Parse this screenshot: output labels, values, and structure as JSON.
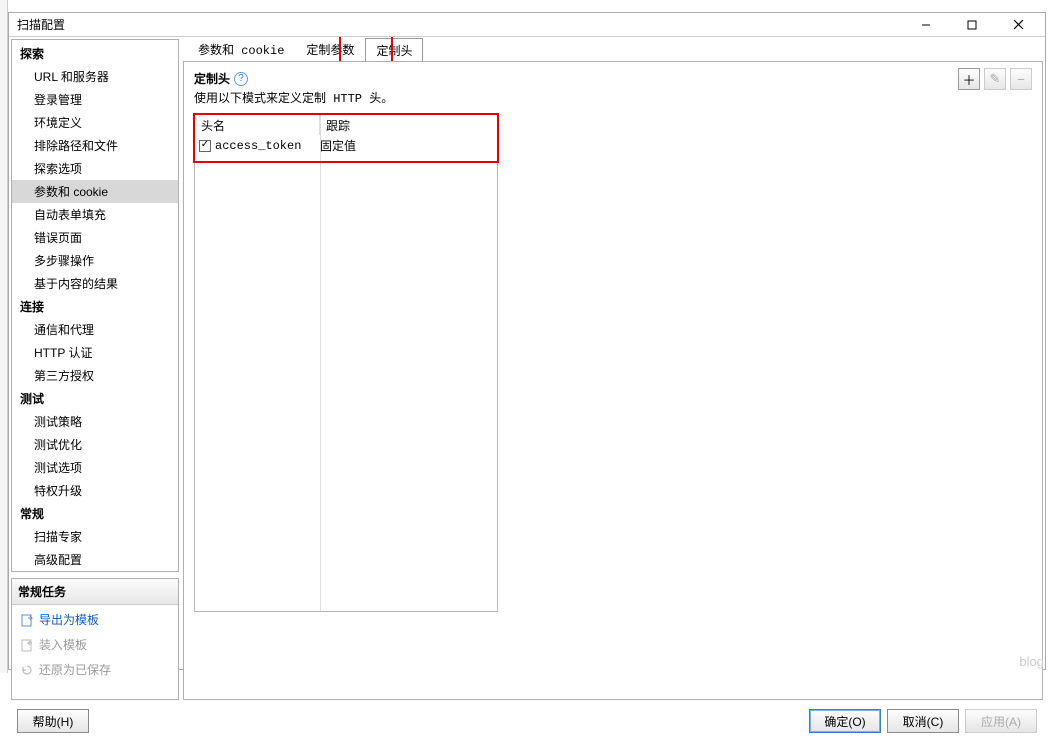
{
  "window": {
    "title": "扫描配置"
  },
  "sidebar": {
    "groups": [
      {
        "label": "探索",
        "items": [
          "URL 和服务器",
          "登录管理",
          "环境定义",
          "排除路径和文件",
          "探索选项",
          "参数和 cookie",
          "自动表单填充",
          "错误页面",
          "多步骤操作",
          "基于内容的结果"
        ],
        "selectedIndex": 5
      },
      {
        "label": "连接",
        "items": [
          "通信和代理",
          "HTTP 认证",
          "第三方授权"
        ]
      },
      {
        "label": "测试",
        "items": [
          "测试策略",
          "测试优化",
          "测试选项",
          "特权升级"
        ]
      },
      {
        "label": "常规",
        "items": [
          "扫描专家",
          "高级配置"
        ]
      }
    ]
  },
  "tasks": {
    "header": "常规任务",
    "items": [
      {
        "label": "导出为模板",
        "type": "link",
        "icon": "export"
      },
      {
        "label": "装入模板",
        "type": "disabled",
        "icon": "import"
      },
      {
        "label": "还原为已保存",
        "type": "disabled",
        "icon": "restore"
      }
    ]
  },
  "tabs": {
    "items": [
      "参数和 cookie",
      "定制参数",
      "定制头"
    ],
    "activeIndex": 2
  },
  "section": {
    "title": "定制头",
    "description": "使用以下模式来定义定制 HTTP 头。"
  },
  "toolbar": {
    "add": "＋",
    "edit": "✎",
    "remove": "−"
  },
  "grid": {
    "headers": [
      "头名",
      "跟踪"
    ],
    "rows": [
      {
        "checked": true,
        "name": "access_token",
        "track": "固定值"
      }
    ]
  },
  "buttons": {
    "help": "帮助(H)",
    "ok": "确定(O)",
    "cancel": "取消(C)",
    "apply": "应用(A)"
  },
  "watermark": "blog"
}
